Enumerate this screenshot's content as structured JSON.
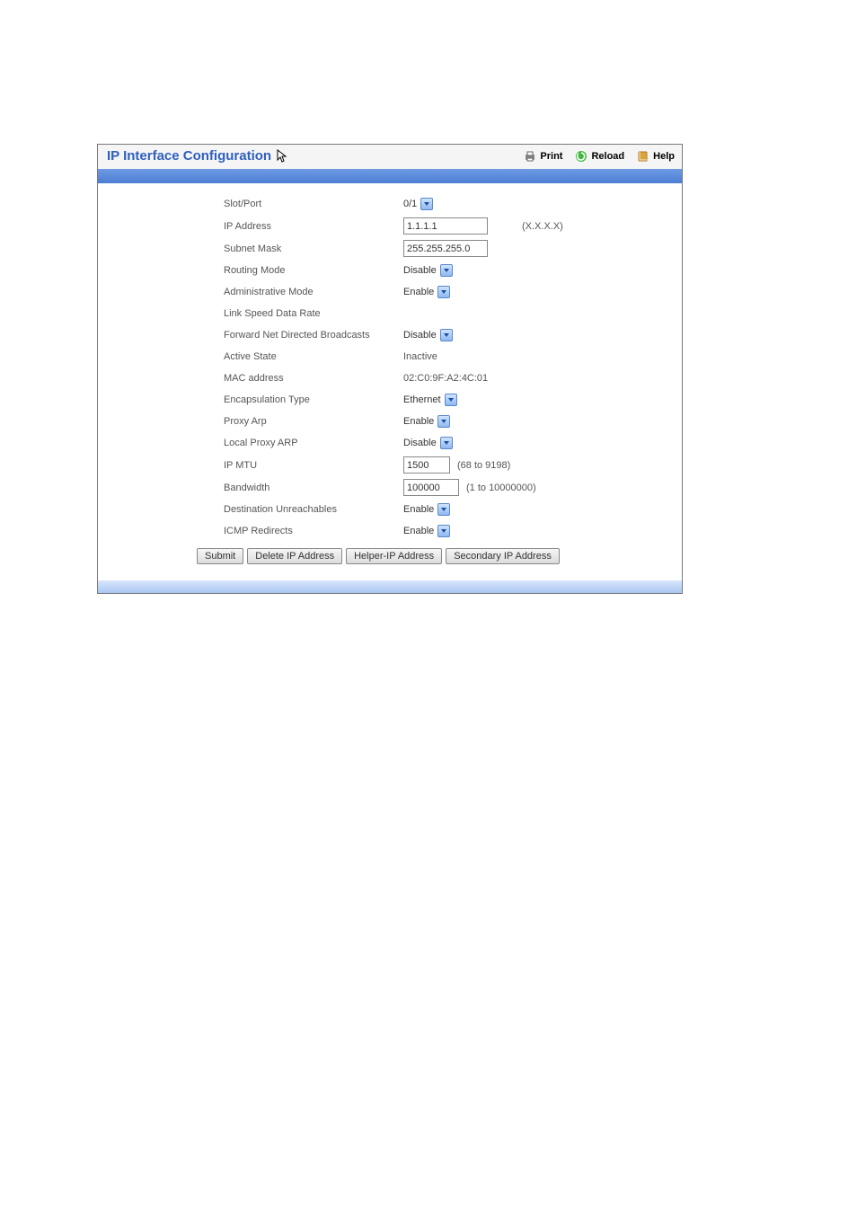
{
  "header": {
    "title": "IP Interface Configuration",
    "actions": {
      "print": "Print",
      "reload": "Reload",
      "help": "Help"
    }
  },
  "form": {
    "slot_port": {
      "label": "Slot/Port",
      "value": "0/1"
    },
    "ip_address": {
      "label": "IP Address",
      "value": "1.1.1.1",
      "hint": "(X.X.X.X)"
    },
    "subnet_mask": {
      "label": "Subnet Mask",
      "value": "255.255.255.0"
    },
    "routing_mode": {
      "label": "Routing Mode",
      "value": "Disable"
    },
    "admin_mode": {
      "label": "Administrative Mode",
      "value": "Enable"
    },
    "link_speed": {
      "label": "Link Speed Data Rate",
      "value": ""
    },
    "fwd_broadcasts": {
      "label": "Forward Net Directed Broadcasts",
      "value": "Disable"
    },
    "active_state": {
      "label": "Active State",
      "value": "Inactive"
    },
    "mac_address": {
      "label": "MAC address",
      "value": "02:C0:9F:A2:4C:01"
    },
    "encapsulation": {
      "label": "Encapsulation Type",
      "value": "Ethernet"
    },
    "proxy_arp": {
      "label": "Proxy Arp",
      "value": "Enable"
    },
    "local_proxy": {
      "label": "Local Proxy ARP",
      "value": "Disable"
    },
    "ip_mtu": {
      "label": "IP MTU",
      "value": "1500",
      "hint": "(68 to 9198)"
    },
    "bandwidth": {
      "label": "Bandwidth",
      "value": "100000",
      "hint": "(1 to 10000000)"
    },
    "dest_unreach": {
      "label": "Destination Unreachables",
      "value": "Enable"
    },
    "icmp_redirects": {
      "label": "ICMP Redirects",
      "value": "Enable"
    }
  },
  "buttons": {
    "submit": "Submit",
    "delete_ip": "Delete IP Address",
    "helper_ip": "Helper-IP Address",
    "secondary_ip": "Secondary IP Address"
  }
}
